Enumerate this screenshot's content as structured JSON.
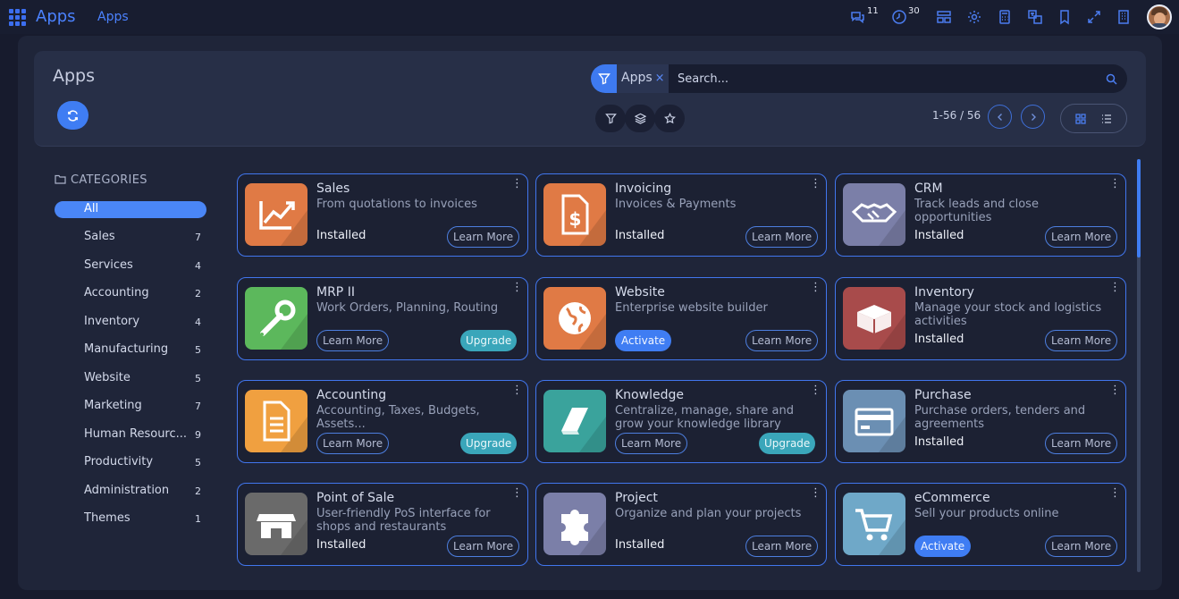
{
  "topbar": {
    "brand": "Apps",
    "breadcrumb": "Apps",
    "icons": [
      "messages-icon",
      "activity-clock-icon",
      "layout-icon",
      "settings-gear-icon",
      "calculator-icon",
      "translate-icon",
      "bookmark-icon",
      "fullscreen-icon",
      "building-icon"
    ],
    "messages_count": "11",
    "activities_count": "30"
  },
  "control": {
    "title": "Apps",
    "facet_label": "Apps",
    "facet_remove": "×",
    "search_placeholder": "Search...",
    "pager": "1-56 / 56"
  },
  "sidebar": {
    "heading": "CATEGORIES",
    "items": [
      {
        "label": "All",
        "count": ""
      },
      {
        "label": "Sales",
        "count": "7"
      },
      {
        "label": "Services",
        "count": "4"
      },
      {
        "label": "Accounting",
        "count": "2"
      },
      {
        "label": "Inventory",
        "count": "4"
      },
      {
        "label": "Manufacturing",
        "count": "5"
      },
      {
        "label": "Website",
        "count": "5"
      },
      {
        "label": "Marketing",
        "count": "7"
      },
      {
        "label": "Human Resourc...",
        "count": "9"
      },
      {
        "label": "Productivity",
        "count": "5"
      },
      {
        "label": "Administration",
        "count": "2"
      },
      {
        "label": "Themes",
        "count": "1"
      }
    ]
  },
  "cards": [
    {
      "name": "Sales",
      "desc": "From quotations to invoices",
      "status": "Installed",
      "learn": "Learn More",
      "action": "",
      "icon": "sales-chart-icon",
      "color": "#e07a45"
    },
    {
      "name": "Invoicing",
      "desc": "Invoices & Payments",
      "status": "Installed",
      "learn": "Learn More",
      "action": "",
      "icon": "invoice-dollar-icon",
      "color": "#e07a45"
    },
    {
      "name": "CRM",
      "desc": "Track leads and close opportunities",
      "status": "Installed",
      "learn": "Learn More",
      "action": "",
      "icon": "handshake-icon",
      "color": "#7b7fa8"
    },
    {
      "name": "MRP II",
      "desc": "Work Orders, Planning, Routing",
      "status": "",
      "learn": "Learn More",
      "action": "Upgrade",
      "icon": "wrench-icon",
      "color": "#5cb85c"
    },
    {
      "name": "Website",
      "desc": "Enterprise website builder",
      "status": "",
      "learn": "Learn More",
      "action": "Activate",
      "icon": "globe-icon",
      "color": "#e07a45"
    },
    {
      "name": "Inventory",
      "desc": "Manage your stock and logistics activities",
      "status": "Installed",
      "learn": "Learn More",
      "action": "",
      "icon": "box-icon",
      "color": "#a84b4b"
    },
    {
      "name": "Accounting",
      "desc": "Accounting, Taxes, Budgets, Assets...",
      "status": "",
      "learn": "Learn More",
      "action": "Upgrade",
      "icon": "document-icon",
      "color": "#f0a040"
    },
    {
      "name": "Knowledge",
      "desc": "Centralize, manage, share and grow your knowledge library",
      "status": "",
      "learn": "Learn More",
      "action": "Upgrade",
      "icon": "book-icon",
      "color": "#3aa39c"
    },
    {
      "name": "Purchase",
      "desc": "Purchase orders, tenders and agreements",
      "status": "Installed",
      "learn": "Learn More",
      "action": "",
      "icon": "credit-card-icon",
      "color": "#6b8fb3"
    },
    {
      "name": "Point of Sale",
      "desc": "User-friendly PoS interface for shops and restaurants",
      "status": "Installed",
      "learn": "Learn More",
      "action": "",
      "icon": "store-icon",
      "color": "#6a6a6a"
    },
    {
      "name": "Project",
      "desc": "Organize and plan your projects",
      "status": "Installed",
      "learn": "Learn More",
      "action": "",
      "icon": "puzzle-icon",
      "color": "#7b7fa8"
    },
    {
      "name": "eCommerce",
      "desc": "Sell your products online",
      "status": "",
      "learn": "Learn More",
      "action": "Activate",
      "icon": "shopping-cart-icon",
      "color": "#6fa8c8"
    }
  ]
}
